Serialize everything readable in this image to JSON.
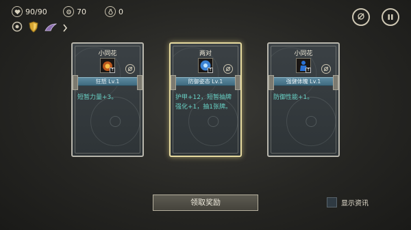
{
  "stats": {
    "hp": "90/90",
    "gold": "70",
    "potions": "0"
  },
  "icons": {
    "hp": "heart-icon",
    "gold": "coin-icon",
    "potion": "potion-icon",
    "map": "map-compass-icon",
    "pause": "pause-icon",
    "relic1": "gear-relic-icon",
    "relic2": "shield-relic-icon",
    "relic3": "feather-relic-icon",
    "more": "chevron-right-icon"
  },
  "cards": [
    {
      "rarity": "小同花",
      "name": "狂怒 Lv.1",
      "desc": "短暂力量+3。",
      "art_color": "#d8641e",
      "selected": false
    },
    {
      "rarity": "两对",
      "name": "防御姿态 Lv.1",
      "desc": "护甲+12，短暂抽牌强化+1，抽1张牌。",
      "art_color": "#3f8ee8",
      "selected": true
    },
    {
      "rarity": "小同花",
      "name": "强健体魄 Lv.1",
      "desc": "防御性能+1。",
      "art_color": "#2a72d6",
      "selected": false
    }
  ],
  "claim_label": "领取奖励",
  "show_info_label": "显示资讯",
  "colors": {
    "desc_text": "#68d2c6",
    "banner": "#4d7a8e",
    "selected_border": "#e8dca0"
  }
}
